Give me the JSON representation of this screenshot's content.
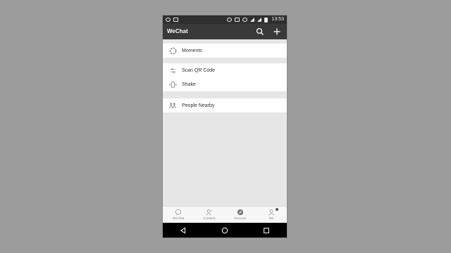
{
  "status_bar": {
    "time": "13:53"
  },
  "app_bar": {
    "title": "WeChat"
  },
  "discover_items": [
    {
      "label": "Moments"
    },
    {
      "label": "Scan QR Code"
    },
    {
      "label": "Shake"
    },
    {
      "label": "People Nearby"
    }
  ],
  "tabs": [
    {
      "label": "WeChat"
    },
    {
      "label": "Contacts"
    },
    {
      "label": "Discover"
    },
    {
      "label": "Me"
    }
  ],
  "colors": {
    "background": "#9c9c9c",
    "status_bar": "#2f2f2f",
    "app_bar": "#393939",
    "list_background": "#e6e6e6",
    "row_background": "#ffffff",
    "nav_bar": "#000000"
  }
}
